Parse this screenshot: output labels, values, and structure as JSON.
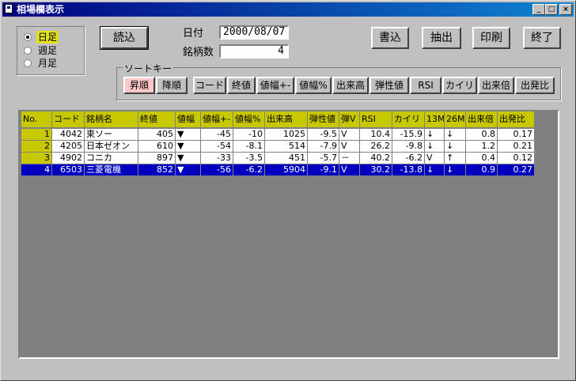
{
  "window": {
    "title": "相場欄表示"
  },
  "period": {
    "options": [
      {
        "label": "日足",
        "selected": true
      },
      {
        "label": "週足",
        "selected": false
      },
      {
        "label": "月足",
        "selected": false
      }
    ]
  },
  "buttons": {
    "read": "読込",
    "write": "書込",
    "extract": "抽出",
    "print": "印刷",
    "exit": "終了"
  },
  "info": {
    "date_label": "日付",
    "date_value": "2000/08/07",
    "count_label": "銘柄数",
    "count_value": "4"
  },
  "sort": {
    "legend": "ソートキー",
    "asc": "昇順",
    "desc": "降順",
    "keys": [
      "コード",
      "終値",
      "値幅+-",
      "値幅%",
      "出来高",
      "弾性値",
      "RSI",
      "カイリ",
      "出来倍",
      "出発比"
    ]
  },
  "table": {
    "headers": [
      "No.",
      "コード",
      "銘柄名",
      "終値",
      "値幅",
      "値幅+-",
      "値幅%",
      "出来高",
      "弾性値",
      "弾V",
      "RSI",
      "カイリ",
      "13M",
      "26M",
      "出来倍",
      "出発比"
    ],
    "rows": [
      [
        "1",
        "4042",
        "東ソー",
        "405",
        "▼",
        "-45",
        "-10",
        "1025",
        "-9.5",
        "V",
        "10.4",
        "-15.9",
        "↓",
        "↓",
        "0.8",
        "0.17"
      ],
      [
        "2",
        "4205",
        "日本ゼオン",
        "610",
        "▼",
        "-54",
        "-8.1",
        "514",
        "-7.9",
        "V",
        "26.2",
        "-9.8",
        "↓",
        "↓",
        "1.2",
        "0.21"
      ],
      [
        "3",
        "4902",
        "コニカ",
        "897",
        "▼",
        "-33",
        "-3.5",
        "451",
        "-5.7",
        "－",
        "40.2",
        "-6.2",
        "V",
        "↑",
        "0.4",
        "0.12"
      ],
      [
        "4",
        "6503",
        "三菱電機",
        "852",
        "▼",
        "-56",
        "-6.2",
        "5904",
        "-9.1",
        "V",
        "30.2",
        "-13.8",
        "↓",
        "↓",
        "0.9",
        "0.27"
      ]
    ],
    "selected_row": 3
  }
}
